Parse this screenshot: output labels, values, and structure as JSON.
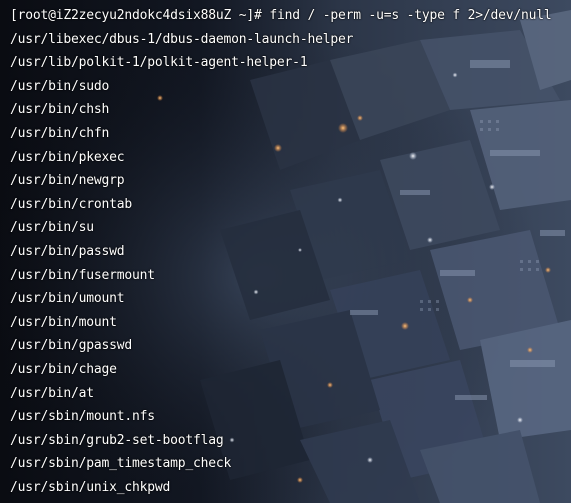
{
  "terminal": {
    "prompt": "[root@iZ2zecyu2ndokc4dsix88uZ ~]# ",
    "command": "find / -perm -u=s -type f 2>/dev/null",
    "output": [
      "/usr/libexec/dbus-1/dbus-daemon-launch-helper",
      "/usr/lib/polkit-1/polkit-agent-helper-1",
      "/usr/bin/sudo",
      "/usr/bin/chsh",
      "/usr/bin/chfn",
      "/usr/bin/pkexec",
      "/usr/bin/newgrp",
      "/usr/bin/crontab",
      "/usr/bin/su",
      "/usr/bin/passwd",
      "/usr/bin/fusermount",
      "/usr/bin/umount",
      "/usr/bin/mount",
      "/usr/bin/gpasswd",
      "/usr/bin/chage",
      "/usr/bin/at",
      "/usr/sbin/mount.nfs",
      "/usr/sbin/grub2-set-bootflag",
      "/usr/sbin/pam_timestamp_check",
      "/usr/sbin/unix_chkpwd"
    ]
  },
  "colors": {
    "text": "#ffffff",
    "background": "#0c0f17",
    "bokeh_warm": "#f4a25a",
    "bokeh_cool": "#e8eefc"
  }
}
